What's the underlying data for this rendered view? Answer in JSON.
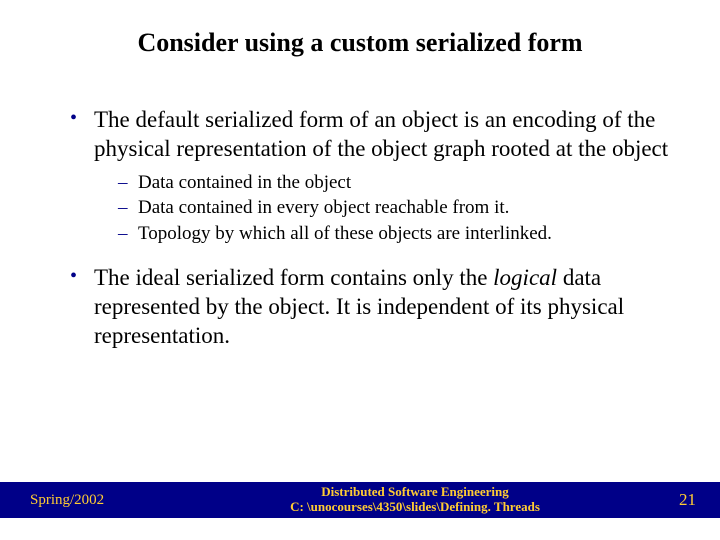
{
  "title": "Consider using a custom serialized form",
  "bullets": [
    {
      "text": "The default serialized form of an object is an encoding of the physical representation of the object graph rooted at the object",
      "sub": [
        "Data contained in the object",
        "Data contained in every object reachable from it.",
        "Topology by which all of these objects are interlinked."
      ]
    },
    {
      "pre": "The ideal serialized form contains only the ",
      "em": "logical",
      "post": " data represented by the object. It is independent of its physical representation."
    }
  ],
  "footer": {
    "left": "Spring/2002",
    "center1": "Distributed Software Engineering",
    "center2": "C: \\unocourses\\4350\\slides\\Defining. Threads",
    "right": "21"
  }
}
